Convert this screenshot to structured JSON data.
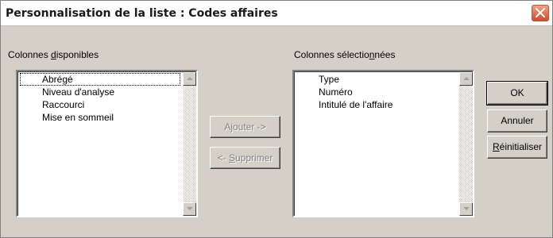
{
  "dialog": {
    "title": "Personnalisation de la liste : Codes affaires",
    "colors": {
      "face": "#d4d0c8",
      "close": "#d24a2a"
    }
  },
  "available": {
    "label_pre": "Colonnes ",
    "label_key": "d",
    "label_post": "isponibles",
    "items": [
      "Abrégé",
      "Niveau d'analyse",
      "Raccourci",
      "Mise en sommeil"
    ]
  },
  "selected": {
    "label_pre": "Colonnes sélectio",
    "label_key": "n",
    "label_post": "nées",
    "items": [
      "Type",
      "Numéro",
      "Intitulé de l'affaire"
    ]
  },
  "actions": {
    "add_label": "Ajouter ->",
    "remove_pre": "<- ",
    "remove_key": "S",
    "remove_post": "upprimer"
  },
  "buttons": {
    "ok": "OK",
    "cancel": "Annuler",
    "reset_key": "R",
    "reset_post": "éinitialiser"
  },
  "icons": {
    "close": "close-icon",
    "scroll_up": "scroll-up-icon",
    "scroll_down": "scroll-down-icon"
  }
}
